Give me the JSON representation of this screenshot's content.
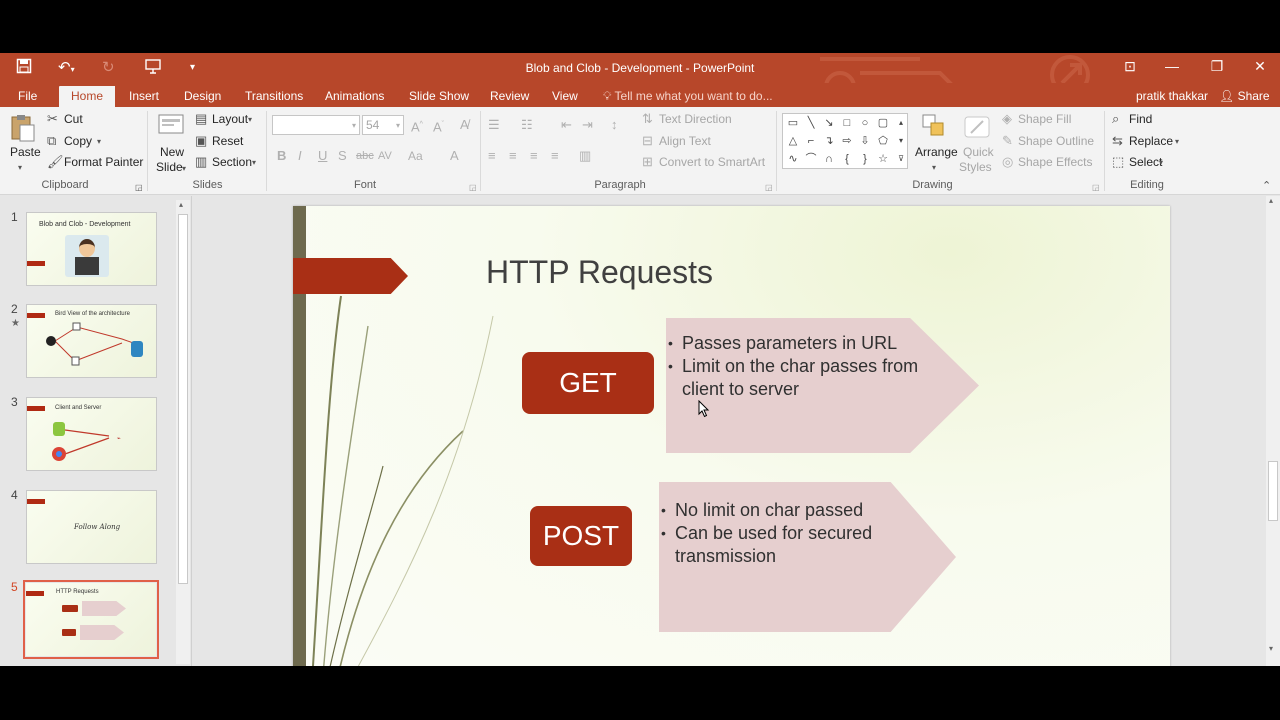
{
  "window": {
    "title": "Blob and Clob - Development - PowerPoint",
    "user": "pratik thakkar",
    "share_label": "Share"
  },
  "tabs": [
    {
      "label": "File"
    },
    {
      "label": "Home"
    },
    {
      "label": "Insert"
    },
    {
      "label": "Design"
    },
    {
      "label": "Transitions"
    },
    {
      "label": "Animations"
    },
    {
      "label": "Slide Show"
    },
    {
      "label": "Review"
    },
    {
      "label": "View"
    }
  ],
  "tell_me": "Tell me what you want to do...",
  "ribbon": {
    "clipboard": {
      "paste": "Paste",
      "cut": "Cut",
      "copy": "Copy",
      "format_painter": "Format Painter",
      "label": "Clipboard"
    },
    "slides": {
      "new_slide_1": "New",
      "new_slide_2": "Slide",
      "layout": "Layout",
      "reset": "Reset",
      "section": "Section",
      "label": "Slides"
    },
    "font": {
      "size": "54",
      "label": "Font"
    },
    "paragraph": {
      "text_direction": "Text Direction",
      "align_text": "Align Text",
      "convert_smartart": "Convert to SmartArt",
      "label": "Paragraph"
    },
    "drawing": {
      "arrange": "Arrange",
      "quick_1": "Quick",
      "quick_2": "Styles",
      "shape_fill": "Shape Fill",
      "shape_outline": "Shape Outline",
      "shape_effects": "Shape Effects",
      "label": "Drawing"
    },
    "editing": {
      "find": "Find",
      "replace": "Replace",
      "select": "Select",
      "label": "Editing"
    }
  },
  "thumbnails": [
    {
      "num": "1",
      "title": "Blob and Clob - Development"
    },
    {
      "num": "2",
      "title": "Bird View of the architecture"
    },
    {
      "num": "3",
      "title": "Client and Server"
    },
    {
      "num": "4",
      "title": "Follow Along"
    },
    {
      "num": "5",
      "title": "HTTP Requests"
    }
  ],
  "slide": {
    "title": "HTTP Requests",
    "get_label": "GET",
    "get_bullets": [
      "Passes parameters in URL",
      "Limit on the char passes from client to server"
    ],
    "post_label": "POST",
    "post_bullets": [
      "No limit on char passed",
      "Can be used for secured transmission"
    ]
  },
  "colors": {
    "accent": "#b7472a",
    "pill": "#a92f15",
    "arrow": "#e6cfcf"
  }
}
